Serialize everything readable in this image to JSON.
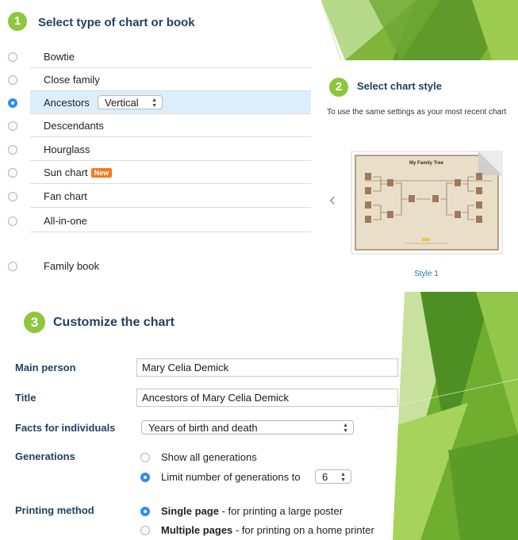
{
  "step1": {
    "number": "1",
    "title": "Select type of chart or book",
    "chart_types": [
      {
        "label": "Bowtie",
        "selected": false
      },
      {
        "label": "Close family",
        "selected": false
      },
      {
        "label": "Ancestors",
        "selected": true,
        "orientation": "Vertical"
      },
      {
        "label": "Descendants",
        "selected": false
      },
      {
        "label": "Hourglass",
        "selected": false
      },
      {
        "label": "Sun chart",
        "selected": false,
        "badge": "New"
      },
      {
        "label": "Fan chart",
        "selected": false
      },
      {
        "label": "All-in-one",
        "selected": false
      }
    ],
    "family_book": {
      "label": "Family book",
      "selected": false
    }
  },
  "step2": {
    "number": "2",
    "title": "Select chart style",
    "note": "To use the same settings as your most recent chart",
    "prev_arrow": "‹",
    "style_label": "Style 1",
    "thumbnail_title": "My Family Tree"
  },
  "step3": {
    "number": "3",
    "title": "Customize the chart",
    "main_person": {
      "label": "Main person",
      "value": "Mary Celia Demick"
    },
    "title_field": {
      "label": "Title",
      "value": "Ancestors of Mary Celia Demick"
    },
    "facts": {
      "label": "Facts for individuals",
      "value": "Years of birth and death"
    },
    "generations": {
      "label": "Generations",
      "option_all": "Show all generations",
      "option_limit": "Limit number of generations to",
      "limit_value": "6",
      "selected": "limit"
    },
    "printing": {
      "label": "Printing method",
      "single_bold": "Single page",
      "single_rest": " - for printing a large poster",
      "multiple_bold": "Multiple pages",
      "multiple_rest": " - for printing on a home printer",
      "selected": "single"
    }
  },
  "colors": {
    "accent_green": "#8dc63f",
    "radio_blue": "#2d8ef0",
    "selected_row": "#dceefb",
    "badge_orange": "#f27a1e",
    "heading_navy": "#1f3f5f"
  }
}
